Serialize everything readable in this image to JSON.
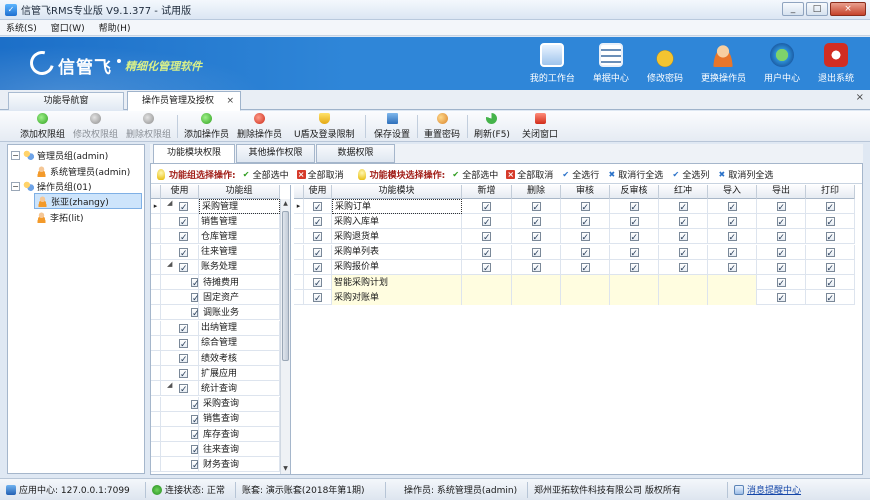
{
  "window": {
    "title": "信管飞RMS专业版 V9.1.377 - 试用版",
    "minimize": "_",
    "maximize": "□",
    "close": "×"
  },
  "menu": [
    "系统(S)",
    "窗口(W)",
    "帮助(H)"
  ],
  "banner": {
    "logo": "信管飞",
    "slogan": "精细化管理软件",
    "nav": [
      {
        "label": "我的工作台",
        "icon": "desktop-icon"
      },
      {
        "label": "单据中心",
        "icon": "document-icon"
      },
      {
        "label": "修改密码",
        "icon": "lock-icon"
      },
      {
        "label": "更换操作员",
        "icon": "user-icon"
      },
      {
        "label": "用户中心",
        "icon": "globe-icon"
      },
      {
        "label": "退出系统",
        "icon": "power-icon"
      }
    ]
  },
  "tabs": {
    "nav": "功能导航窗",
    "doc": "操作员管理及授权",
    "close": "×",
    "close_all": "×"
  },
  "toolbar": [
    {
      "label": "添加权限组",
      "disabled": false,
      "icon": "add-icon"
    },
    {
      "label": "修改权限组",
      "disabled": true,
      "icon": "edit-icon"
    },
    {
      "label": "删除权限组",
      "disabled": true,
      "icon": "delete-icon"
    },
    {
      "label": "添加操作员",
      "disabled": false,
      "icon": "add-icon"
    },
    {
      "label": "删除操作员",
      "disabled": false,
      "icon": "delete-icon"
    },
    {
      "label": "U盾及登录限制",
      "disabled": false,
      "icon": "shield-icon"
    },
    {
      "label": "保存设置",
      "disabled": false,
      "icon": "save-icon"
    },
    {
      "label": "重置密码",
      "disabled": false,
      "icon": "key-icon"
    },
    {
      "label": "刷新(F5)",
      "disabled": false,
      "icon": "refresh-icon"
    },
    {
      "label": "关闭窗口",
      "disabled": false,
      "icon": "close-window-icon"
    }
  ],
  "tree": [
    {
      "label": "管理员组(admin)",
      "level": 0,
      "toggle": "−",
      "icon": "group-icon"
    },
    {
      "label": "系统管理员(admin)",
      "level": 1,
      "toggle": "",
      "icon": "person-icon"
    },
    {
      "label": "操作员组(01)",
      "level": 0,
      "toggle": "−",
      "icon": "group-icon"
    },
    {
      "label": "张亚(zhangy)",
      "level": 1,
      "toggle": "",
      "icon": "person-icon",
      "selected": true
    },
    {
      "label": "李拓(lit)",
      "level": 1,
      "toggle": "",
      "icon": "person-icon"
    }
  ],
  "subtabs": [
    "功能模块权限",
    "其他操作权限",
    "数据权限"
  ],
  "group_actions": {
    "title": "功能组选择操作:",
    "items": [
      "全部选中",
      "全部取消"
    ]
  },
  "module_actions": {
    "title": "功能模块选择操作:",
    "items": [
      "全部选中",
      "全部取消",
      "全选行",
      "取消行全选",
      "全选列",
      "取消列全选"
    ]
  },
  "left_grid": {
    "headers": [
      "使用",
      "功能组"
    ],
    "rows": [
      {
        "name": "采购管理",
        "level": 0,
        "group": true,
        "checked": true,
        "current": true
      },
      {
        "name": "销售管理",
        "level": 0,
        "group": false,
        "checked": true
      },
      {
        "name": "仓库管理",
        "level": 0,
        "group": false,
        "checked": true
      },
      {
        "name": "往来管理",
        "level": 0,
        "group": false,
        "checked": true
      },
      {
        "name": "账务处理",
        "level": 0,
        "group": true,
        "checked": true
      },
      {
        "name": "待摊费用",
        "level": 1,
        "group": false,
        "checked": true
      },
      {
        "name": "固定资产",
        "level": 1,
        "group": false,
        "checked": true
      },
      {
        "name": "调账业务",
        "level": 1,
        "group": false,
        "checked": true
      },
      {
        "name": "出纳管理",
        "level": 0,
        "group": false,
        "checked": true
      },
      {
        "name": "综合管理",
        "level": 0,
        "group": false,
        "checked": true
      },
      {
        "name": "绩效考核",
        "level": 0,
        "group": false,
        "checked": true
      },
      {
        "name": "扩展应用",
        "level": 0,
        "group": false,
        "checked": true
      },
      {
        "name": "统计查询",
        "level": 0,
        "group": true,
        "checked": true
      },
      {
        "name": "采购查询",
        "level": 1,
        "group": false,
        "checked": true
      },
      {
        "name": "销售查询",
        "level": 1,
        "group": false,
        "checked": true
      },
      {
        "name": "库存查询",
        "level": 1,
        "group": false,
        "checked": true
      },
      {
        "name": "往来查询",
        "level": 1,
        "group": false,
        "checked": true
      },
      {
        "name": "财务查询",
        "level": 1,
        "group": false,
        "checked": true
      }
    ]
  },
  "right_grid": {
    "headers": [
      "使用",
      "功能模块",
      "新增",
      "删除",
      "审核",
      "反审核",
      "红冲",
      "导入",
      "导出",
      "打印"
    ],
    "rows": [
      {
        "name": "采购订单",
        "use": true,
        "perms": [
          true,
          true,
          true,
          true,
          true,
          true,
          true,
          true
        ],
        "current": true
      },
      {
        "name": "采购入库单",
        "use": true,
        "perms": [
          true,
          true,
          true,
          true,
          true,
          true,
          true,
          true
        ]
      },
      {
        "name": "采购退货单",
        "use": true,
        "perms": [
          true,
          true,
          true,
          true,
          true,
          true,
          true,
          true
        ]
      },
      {
        "name": "采购单列表",
        "use": true,
        "perms": [
          true,
          true,
          true,
          true,
          true,
          true,
          true,
          true
        ]
      },
      {
        "name": "采购报价单",
        "use": true,
        "perms": [
          true,
          true,
          true,
          true,
          true,
          true,
          true,
          true
        ]
      },
      {
        "name": "智能采购计划",
        "use": true,
        "perms": [
          null,
          null,
          null,
          null,
          null,
          null,
          true,
          true
        ]
      },
      {
        "name": "采购对账单",
        "use": true,
        "perms": [
          null,
          null,
          null,
          null,
          null,
          null,
          true,
          true
        ]
      }
    ]
  },
  "scrollbar": {
    "up": "▲",
    "down": "▼"
  },
  "status": {
    "app_center": "应用中心: 127.0.0.1:7099",
    "connection": "连接状态: 正常",
    "account": "账套: 演示账套(2018年第1期)",
    "operator": "操作员: 系统管理员(admin)",
    "copyright": "郑州亚拓软件科技有限公司 版权所有",
    "message": "消息提醒中心"
  }
}
